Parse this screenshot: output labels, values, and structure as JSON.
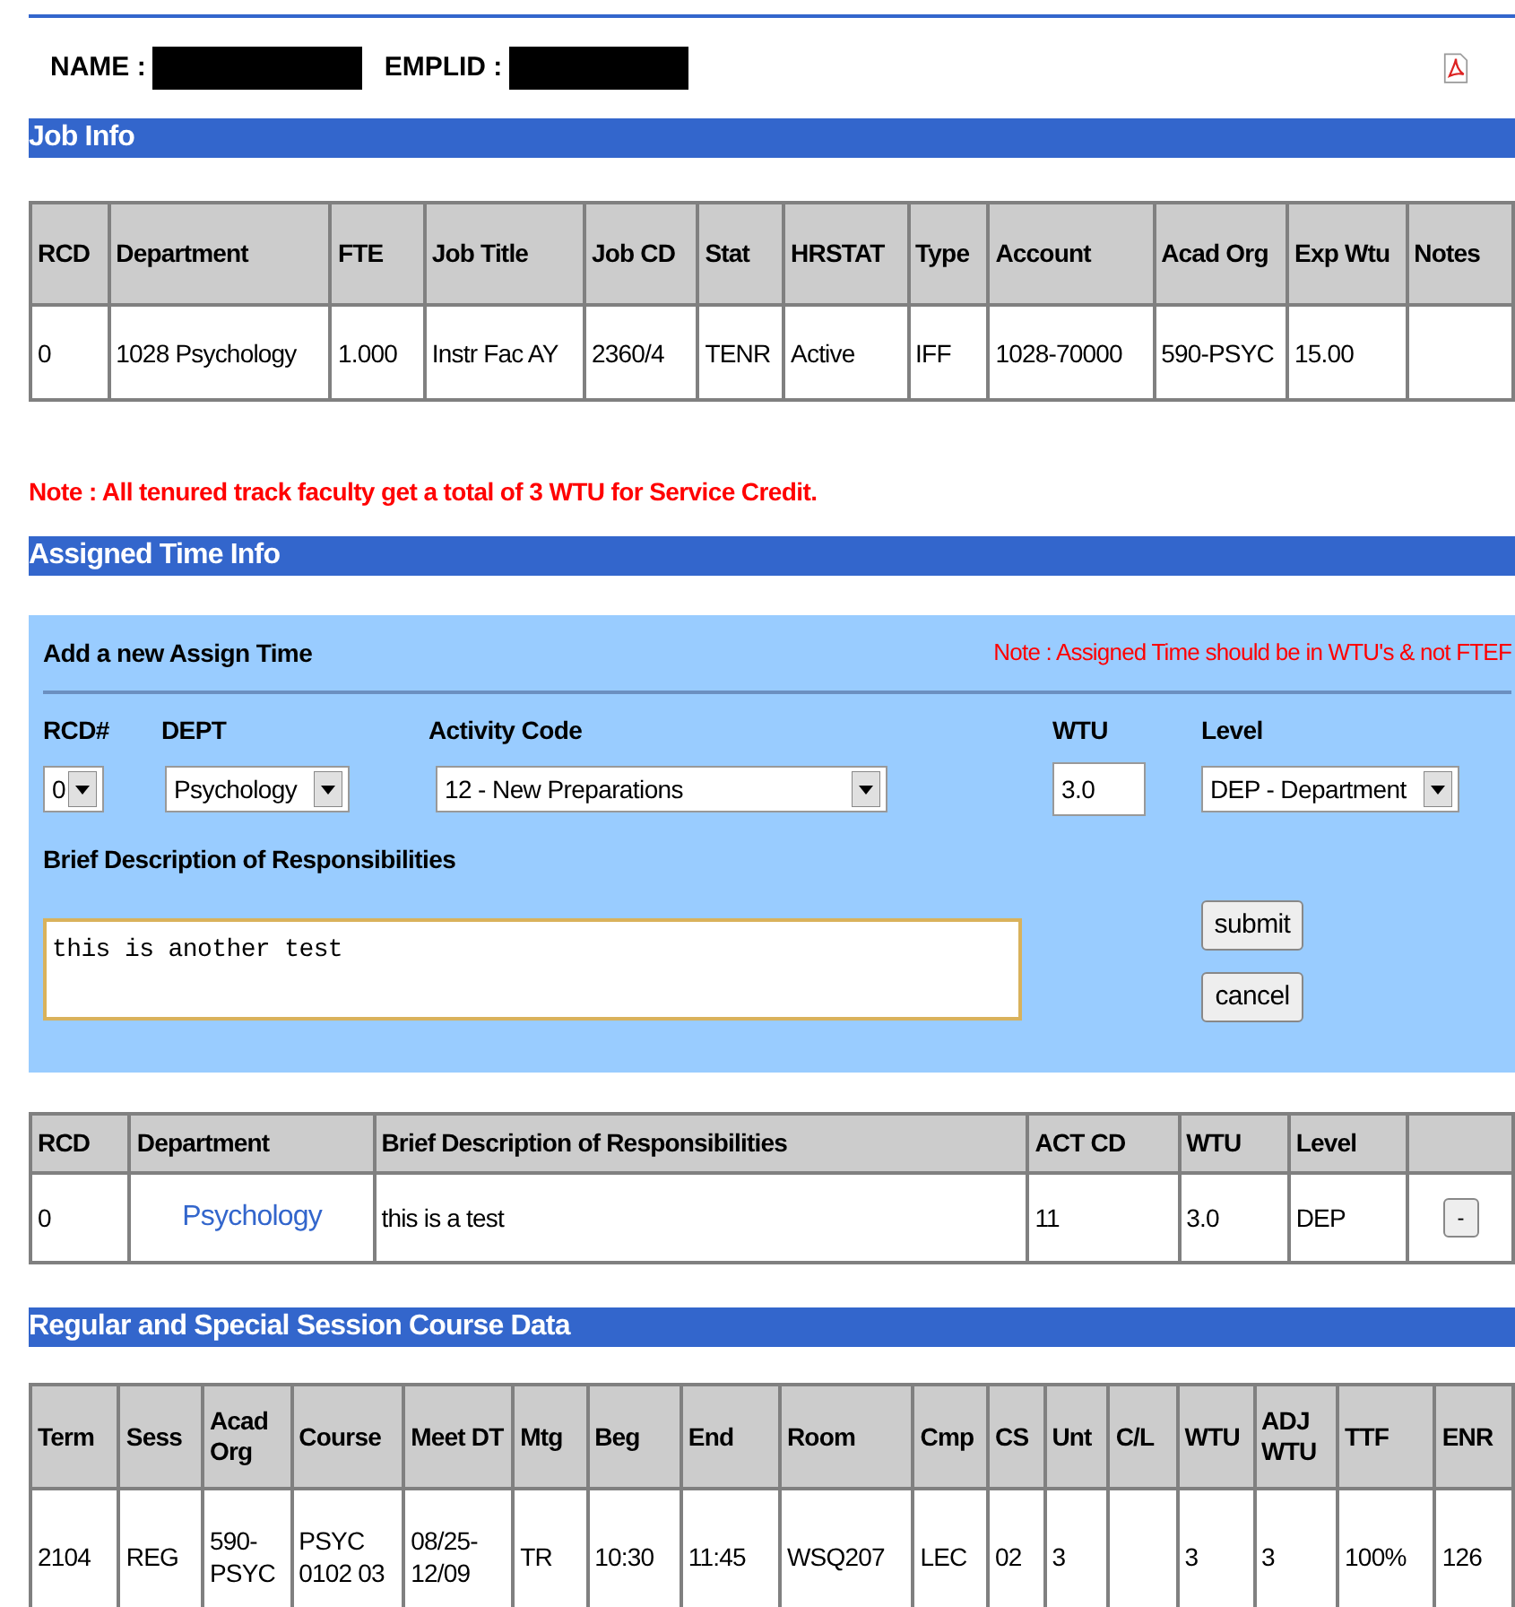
{
  "header": {
    "name_label": "NAME :",
    "emplid_label": "EMPLID :"
  },
  "job_info": {
    "title": "Job Info",
    "columns": [
      "RCD",
      "Department",
      "FTE",
      "Job Title",
      "Job CD",
      "Stat",
      "HRSTAT",
      "Type",
      "Account",
      "Acad Org",
      "Exp Wtu",
      "Notes"
    ],
    "rows": [
      [
        "0",
        "1028 Psychology",
        "1.000",
        "Instr Fac AY",
        "2360/4",
        "TENR",
        "Active",
        "IFF",
        "1028-70000",
        "590-PSYC",
        "15.00",
        ""
      ]
    ]
  },
  "note": "Note : All tenured track faculty get a total of 3 WTU for Service Credit.",
  "assigned_time": {
    "title": "Assigned Time Info",
    "form": {
      "title": "Add a new Assign Time",
      "note": "Note : Assigned Time should be in WTU's & not FTEF",
      "fields": [
        {
          "kind": "select",
          "label": "RCD#",
          "value": "0"
        },
        {
          "kind": "select",
          "label": "DEPT",
          "value": "Psychology"
        },
        {
          "kind": "select",
          "label": "Activity Code",
          "value": "12 - New Preparations"
        },
        {
          "kind": "input",
          "label": "WTU",
          "value": "3.0"
        },
        {
          "kind": "select",
          "label": "Level",
          "value": "DEP - Department"
        }
      ],
      "description_label": "Brief Description of Responsibilities",
      "description_value": "this is another test",
      "buttons": [
        "submit",
        "cancel"
      ]
    },
    "columns": [
      "RCD",
      "Department",
      "Brief Description of Responsibilities",
      "ACT CD",
      "WTU",
      "Level",
      ""
    ],
    "rows": [
      {
        "rcd": "0",
        "department": "Psychology",
        "description": "this is a test",
        "act_cd": "11",
        "wtu": "3.0",
        "level": "DEP",
        "action": "-"
      }
    ]
  },
  "course_data": {
    "title": "Regular and Special Session Course Data",
    "columns": [
      "Term",
      "Sess",
      "Acad Org",
      "Course",
      "Meet DT",
      "Mtg",
      "Beg",
      "End",
      "Room",
      "Cmp",
      "CS",
      "Unt",
      "C/L",
      "WTU",
      "ADJ WTU",
      "TTF",
      "ENR"
    ],
    "rows": [
      [
        "2104",
        "REG",
        "590-PSYC",
        "PSYC 0102 03",
        "08/25-12/09",
        "TR",
        "10:30",
        "11:45",
        "WSQ207",
        "LEC",
        "02",
        "3",
        "",
        "3",
        "3",
        "100%",
        "126"
      ]
    ]
  }
}
